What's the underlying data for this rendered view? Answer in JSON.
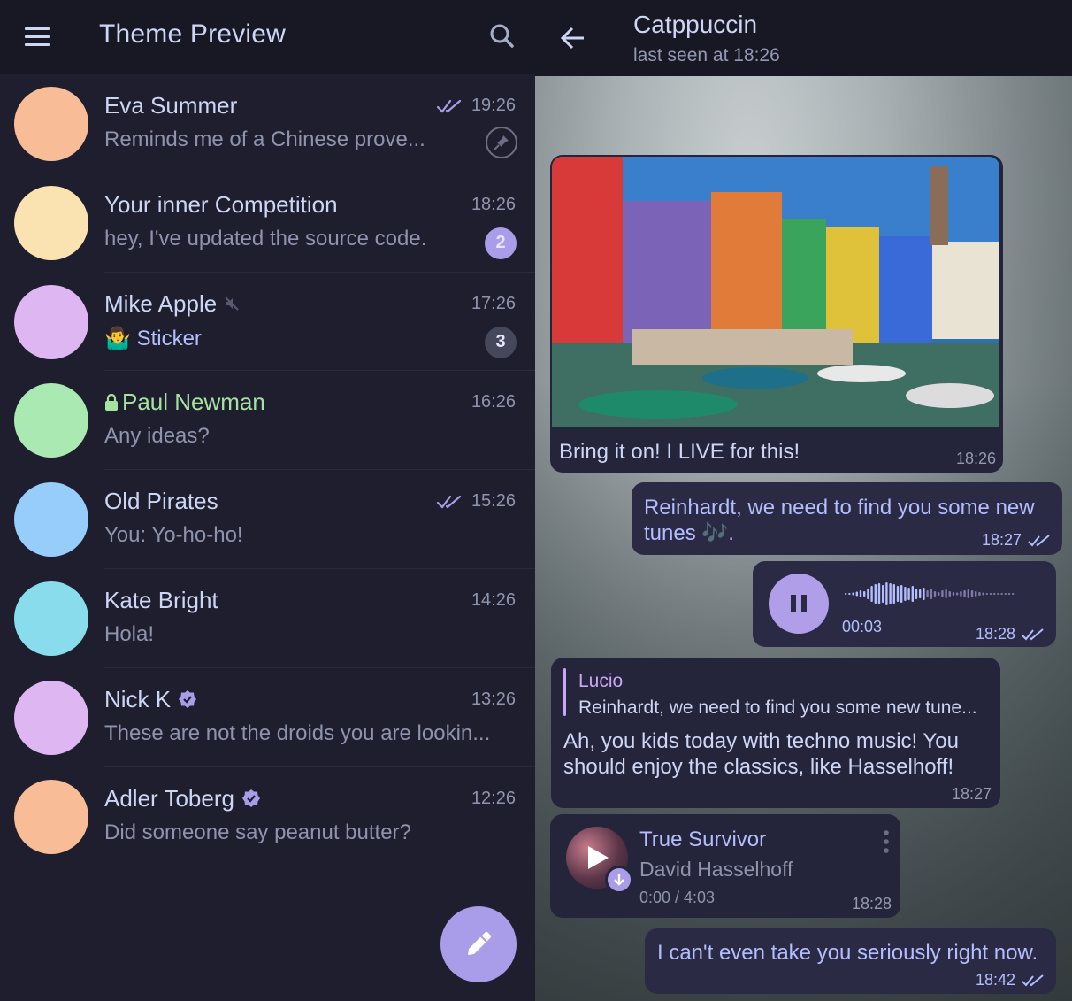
{
  "app": {
    "title": "Theme Preview"
  },
  "chats": [
    {
      "name": "Eva Summer",
      "preview": "Reminds me of a Chinese prove...",
      "time": "19:26",
      "avatar_color": "#f8bd96",
      "read": true,
      "pinned": true
    },
    {
      "name": "Your inner Competition",
      "preview": "hey, I've updated the source code.",
      "time": "18:26",
      "avatar_color": "#fae3b0",
      "unread": "2",
      "badge_color": "#a99ce8"
    },
    {
      "name": "Mike Apple",
      "preview_emoji": "🤷‍♂️",
      "preview": "Sticker",
      "time": "17:26",
      "avatar_color": "#ddb6f2",
      "muted": true,
      "unread": "3",
      "badge_color": "#45475a"
    },
    {
      "name": "Paul Newman",
      "preview": "Any ideas?",
      "time": "16:26",
      "avatar_color": "#abe9b3",
      "secret": true
    },
    {
      "name": "Old Pirates",
      "preview": "You: Yo-ho-ho!",
      "time": "15:26",
      "avatar_color": "#96cdfb",
      "read": true
    },
    {
      "name": "Kate Bright",
      "preview": "Hola!",
      "time": "14:26",
      "avatar_color": "#89dceb"
    },
    {
      "name": "Nick K",
      "preview": "These are not the droids you are lookin...",
      "time": "13:26",
      "avatar_color": "#ddb6f2",
      "verified": true
    },
    {
      "name": "Adler Toberg",
      "preview": "Did someone say peanut butter?",
      "time": "12:26",
      "avatar_color": "#f8bd96",
      "verified": true
    }
  ],
  "conversation": {
    "title": "Catppuccin",
    "status": "last seen at 18:26",
    "messages": {
      "photo": {
        "caption": "Bring it on! I LIVE for this!",
        "time": "18:26"
      },
      "out1": {
        "text_line1": "Reinhardt, we need to find you some new",
        "text_line2": "tunes 🎶.",
        "time": "18:27"
      },
      "voice": {
        "duration": "00:03",
        "time": "18:28"
      },
      "reply": {
        "author": "Lucio",
        "quoted": "Reinhardt, we need to find you some new tune...",
        "text_line1": "Ah, you kids today with techno music! You",
        "text_line2": "should enjoy the classics, like Hasselhoff!",
        "time": "18:27"
      },
      "music": {
        "title": "True Survivor",
        "artist": "David Hasselhoff",
        "progress": "0:00 / 4:03",
        "time": "18:28"
      },
      "out2": {
        "text": "I can't even take you seriously right now.",
        "time": "18:42"
      }
    }
  },
  "colors": {
    "accent": "#a99ce8",
    "text": "#cdd6f4",
    "subtext": "#8f94ae",
    "green": "#a6e3a1",
    "base": "#1e1e2e",
    "mantle": "#181825"
  }
}
